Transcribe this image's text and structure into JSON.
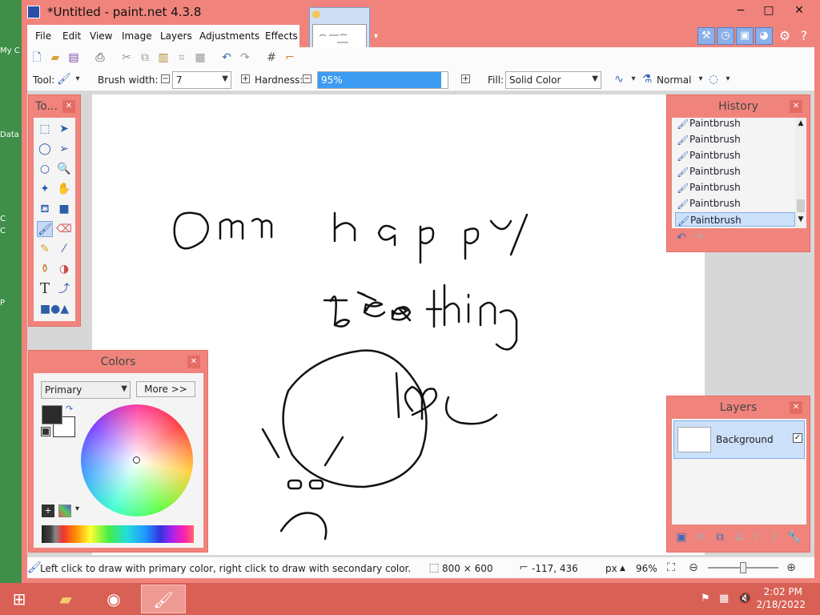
{
  "desktop": {
    "icons": [
      "My C",
      "Data",
      "C",
      "C",
      "P"
    ]
  },
  "window": {
    "title": "*Untitled - paint.net 4.3.8",
    "minimize": "−",
    "maximize": "□",
    "close": "✕"
  },
  "menu": [
    "File",
    "Edit",
    "View",
    "Image",
    "Layers",
    "Adjustments",
    "Effects"
  ],
  "toolbar": {
    "tool_label": "Tool:",
    "brush_width_label": "Brush width:",
    "brush_width_value": "7",
    "hardness_label": "Hardness:",
    "hardness_value": "95%",
    "hardness_fraction": 0.95,
    "fill_label": "Fill:",
    "fill_value": "Solid Color",
    "blend_mode": "Normal"
  },
  "tools_palette": {
    "title": "To..."
  },
  "colors_palette": {
    "title": "Colors",
    "mode": "Primary",
    "more_button": "More >>",
    "primary_color": "#2b2b2b",
    "secondary_color": "#ffffff"
  },
  "history_palette": {
    "title": "History",
    "items": [
      "Paintbrush",
      "Paintbrush",
      "Paintbrush",
      "Paintbrush",
      "Paintbrush",
      "Paintbrush",
      "Paintbrush"
    ]
  },
  "layers_palette": {
    "title": "Layers",
    "layers": [
      {
        "name": "Background",
        "visible": true
      }
    ]
  },
  "status": {
    "hint": "Left click to draw with primary color, right click to draw with secondary color.",
    "image_size": "800 × 600",
    "cursor_pos": "-117, 436",
    "unit": "px",
    "zoom": "96%"
  },
  "taskbar": {
    "time": "2:02 PM",
    "date": "2/18/2022"
  },
  "colors": {
    "accent": "#f0847c",
    "selection": "#cce0fa"
  }
}
